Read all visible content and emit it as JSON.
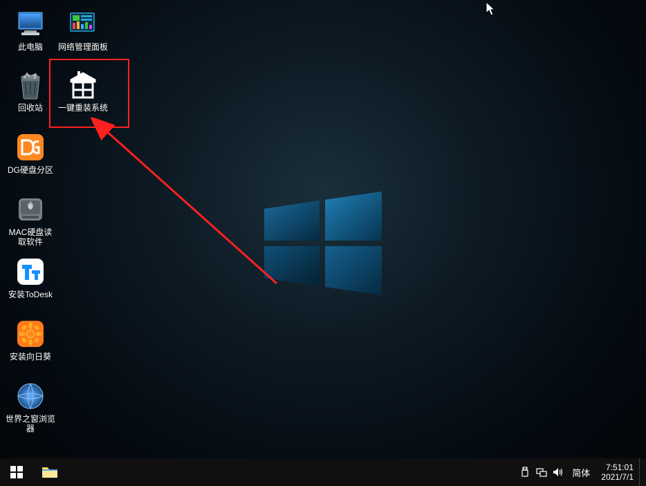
{
  "desktop": {
    "icons": [
      {
        "id": "this-pc",
        "label": "此电脑",
        "col": 0,
        "row": 0
      },
      {
        "id": "network-panel",
        "label": "网络管理面板",
        "col": 1,
        "row": 0
      },
      {
        "id": "recycle-bin",
        "label": "回收站",
        "col": 0,
        "row": 1
      },
      {
        "id": "one-click-reinstall",
        "label": "一键重装系统",
        "col": 1,
        "row": 1,
        "highlighted": true
      },
      {
        "id": "dg-partition",
        "label": "DG硬盘分区",
        "col": 0,
        "row": 2
      },
      {
        "id": "mac-disk-reader",
        "label": "MAC硬盘读取软件",
        "col": 0,
        "row": 3
      },
      {
        "id": "install-todesk",
        "label": "安装ToDesk",
        "col": 0,
        "row": 4
      },
      {
        "id": "install-sunflower",
        "label": "安装向日葵",
        "col": 0,
        "row": 5
      },
      {
        "id": "world-window-browser",
        "label": "世界之窗浏览器",
        "col": 0,
        "row": 6
      }
    ]
  },
  "taskbar": {
    "start": "开始",
    "explorer": "文件资源管理器",
    "ime_label": "简体",
    "time": "7:51:01",
    "date": "2021/7/1"
  },
  "annotation": {
    "highlight_target": "one-click-reinstall"
  }
}
